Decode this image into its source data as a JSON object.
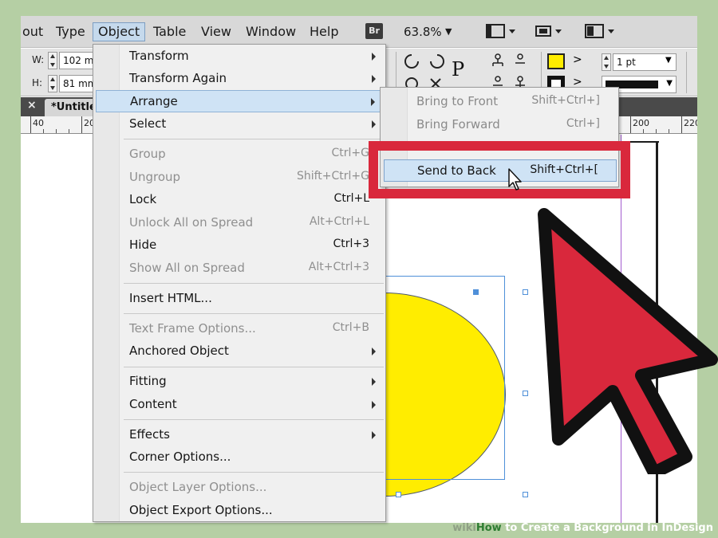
{
  "menubar": {
    "items": [
      "out",
      "Type",
      "Object",
      "Table",
      "View",
      "Window",
      "Help"
    ],
    "bridge_badge": "Br",
    "zoom": "63.8%"
  },
  "control_panel": {
    "w_label": "W:",
    "w_value": "102 m",
    "h_label": "H:",
    "h_value": "81 mm",
    "stroke_weight": "1 pt",
    "text_frame_icon": "P",
    "fill_color": "#ffed00"
  },
  "tab": {
    "close": "×",
    "title": "*Untitle"
  },
  "ruler": {
    "labels": [
      "40",
      "20",
      "200",
      "220"
    ]
  },
  "object_menu": {
    "items": [
      {
        "label": "Transform",
        "shortcut": "",
        "submenu": true,
        "disabled": false
      },
      {
        "label": "Transform Again",
        "shortcut": "",
        "submenu": true,
        "disabled": false
      },
      {
        "label": "Arrange",
        "shortcut": "",
        "submenu": true,
        "disabled": false,
        "highlighted": true
      },
      {
        "label": "Select",
        "shortcut": "",
        "submenu": true,
        "disabled": false
      },
      {
        "label": "Group",
        "shortcut": "Ctrl+G",
        "submenu": false,
        "disabled": true
      },
      {
        "label": "Ungroup",
        "shortcut": "Shift+Ctrl+G",
        "submenu": false,
        "disabled": true
      },
      {
        "label": "Lock",
        "shortcut": "Ctrl+L",
        "submenu": false,
        "disabled": false
      },
      {
        "label": "Unlock All on Spread",
        "shortcut": "Alt+Ctrl+L",
        "submenu": false,
        "disabled": true
      },
      {
        "label": "Hide",
        "shortcut": "Ctrl+3",
        "submenu": false,
        "disabled": false
      },
      {
        "label": "Show All on Spread",
        "shortcut": "Alt+Ctrl+3",
        "submenu": false,
        "disabled": true
      },
      {
        "label": "Insert HTML...",
        "shortcut": "",
        "submenu": false,
        "disabled": false
      },
      {
        "label": "Text Frame Options...",
        "shortcut": "Ctrl+B",
        "submenu": false,
        "disabled": true
      },
      {
        "label": "Anchored Object",
        "shortcut": "",
        "submenu": true,
        "disabled": false
      },
      {
        "label": "Fitting",
        "shortcut": "",
        "submenu": true,
        "disabled": false
      },
      {
        "label": "Content",
        "shortcut": "",
        "submenu": true,
        "disabled": false
      },
      {
        "label": "Effects",
        "shortcut": "",
        "submenu": true,
        "disabled": false
      },
      {
        "label": "Corner Options...",
        "shortcut": "",
        "submenu": false,
        "disabled": false
      },
      {
        "label": "Object Layer Options...",
        "shortcut": "",
        "submenu": false,
        "disabled": true
      },
      {
        "label": "Object Export Options...",
        "shortcut": "",
        "submenu": false,
        "disabled": false
      }
    ]
  },
  "arrange_submenu": {
    "items": [
      {
        "label": "Bring to Front",
        "shortcut": "Shift+Ctrl+]",
        "disabled": true
      },
      {
        "label": "Bring Forward",
        "shortcut": "Ctrl+]",
        "disabled": true
      },
      {
        "label": "Send to Back",
        "shortcut": "Shift+Ctrl+[",
        "disabled": false,
        "highlighted": true
      }
    ]
  },
  "caption": {
    "wiki": "wiki",
    "how": "How",
    "text": " to Create a Background in InDesign"
  },
  "colors": {
    "highlight_red": "#d9283c",
    "shape_fill": "#ffed00",
    "menu_highlight": "#cfe3f5"
  }
}
